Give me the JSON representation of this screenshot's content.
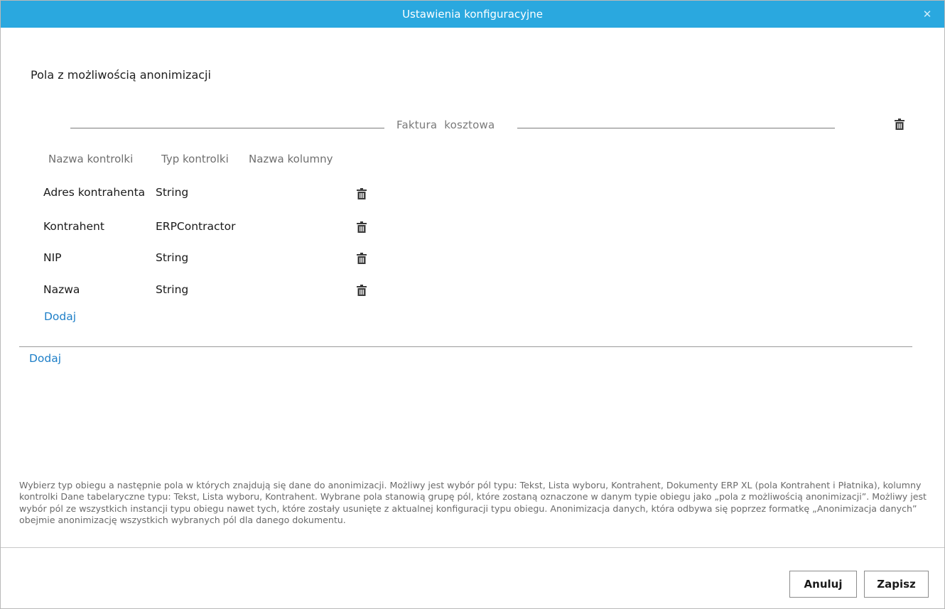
{
  "window": {
    "title": "Ustawienia konfiguracyjne",
    "close_icon": "close-icon"
  },
  "section": {
    "title": "Pola z możliwością anonimizacji"
  },
  "group": {
    "title": "Faktura  kosztowa",
    "delete_icon": "trash-icon"
  },
  "table": {
    "columns": [
      "Nazwa kontrolki",
      "Typ kontrolki",
      "Nazwa kolumny"
    ],
    "rows": [
      {
        "name": "Adres kontrahenta",
        "type": "String",
        "column": ""
      },
      {
        "name": "Kontrahent",
        "type": "ERPContractor",
        "column": ""
      },
      {
        "name": "NIP",
        "type": "String",
        "column": ""
      },
      {
        "name": "Nazwa",
        "type": "String",
        "column": ""
      }
    ],
    "add_label": "Dodaj"
  },
  "add_group_label": "Dodaj",
  "help_text": "Wybierz typ obiegu a następnie pola w których znajdują się dane do anonimizacji. Możliwy jest wybór pól typu: Tekst, Lista wyboru, Kontrahent, Dokumenty ERP XL (pola Kontrahent i Płatnika), kolumny kontrolki Dane tabelaryczne typu: Tekst, Lista wyboru, Kontrahent. Wybrane pola stanowią grupę pól, które zostaną oznaczone w danym typie obiegu jako „pola z możliwością anonimizacji”. Możliwy jest wybór pól ze wszystkich instancji typu obiegu nawet tych, które zostały usunięte z aktualnej konfiguracji typu obiegu. Anonimizacja danych, która odbywa się poprzez formatkę „Anonimizacja danych” obejmie anonimizację wszystkich wybranych pól dla danego dokumentu.",
  "buttons": {
    "cancel": "Anuluj",
    "save": "Zapisz"
  },
  "colors": {
    "titlebar": "#2aa8df",
    "link": "#1e7fc8"
  }
}
